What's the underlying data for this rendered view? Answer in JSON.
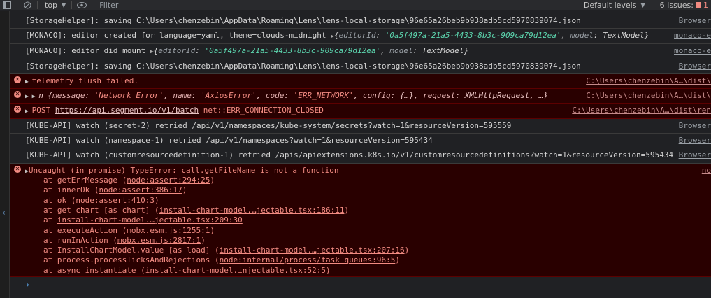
{
  "toolbar": {
    "context": "top",
    "filter_placeholder": "Filter",
    "levels": "Default levels",
    "issues_label": "6 Issues:",
    "issues_count": "1"
  },
  "messages": [
    {
      "type": "info",
      "text": "[StorageHelper]: saving C:\\Users\\chenzebin\\AppData\\Roaming\\Lens\\lens-local-storage\\96e65a26beb9b938adb5cd5970839074.json",
      "src": "Browser"
    },
    {
      "type": "info",
      "prefix": "[MONACO]: editor created for language=yaml, theme=clouds-midnight ",
      "obj": {
        "k1": "editorId",
        "v1": "'0a5f497a-21a5-4433-8b3c-909ca79d12ea'",
        "k2": "model",
        "v2": "TextModel"
      },
      "src": "monaco-e"
    },
    {
      "type": "info",
      "prefix": "[MONACO]: editor did mount ",
      "obj": {
        "k1": "editorId",
        "v1": "'0a5f497a-21a5-4433-8b3c-909ca79d12ea'",
        "k2": "model",
        "v2": "TextModel"
      },
      "src": "monaco-e"
    },
    {
      "type": "info",
      "text": "[StorageHelper]: saving C:\\Users\\chenzebin\\AppData\\Roaming\\Lens\\lens-local-storage\\96e65a26beb9b938adb5cd5970839074.json",
      "src": "Browser"
    },
    {
      "type": "error",
      "text": "telemetry flush failed.",
      "src": "C:\\Users\\chenzebin\\A…\\dist\\"
    },
    {
      "type": "error",
      "fields": {
        "n": "n",
        "message_k": "message",
        "message_v": "'Network Error'",
        "name_k": "name",
        "name_v": "'AxiosError'",
        "code_k": "code",
        "code_v": "'ERR_NETWORK'",
        "config_k": "config",
        "config_v": "{…}",
        "request_k": "request",
        "request_v": "XMLHttpRequest",
        "tail": "…}"
      },
      "src": "C:\\Users\\chenzebin\\A…\\dist\\"
    },
    {
      "type": "error",
      "method": "POST",
      "url": "https://api.segment.io/v1/batch",
      "status": "net::ERR_CONNECTION_CLOSED",
      "src": "C:\\Users\\chenzebin\\A…\\dist\\ren"
    },
    {
      "type": "info",
      "text": "[KUBE-API] watch (secret-2) retried /api/v1/namespaces/kube-system/secrets?watch=1&resourceVersion=595559",
      "src": "Browser"
    },
    {
      "type": "info",
      "text": "[KUBE-API] watch (namespace-1) retried /api/v1/namespaces?watch=1&resourceVersion=595434",
      "src": "Browser"
    },
    {
      "type": "info",
      "text": "[KUBE-API] watch (customresourcedefinition-1) retried /apis/apiextensions.k8s.io/v1/customresourcedefinitions?watch=1&resourceVersion=595434",
      "src": "Browser"
    }
  ],
  "uncaught": {
    "title": "Uncaught (in promise) TypeError: call.getFileName is not a function",
    "src": "no",
    "stack": [
      {
        "pre": "at getErrMessage (",
        "ref": "node:assert:294:25",
        "post": ")"
      },
      {
        "pre": "at innerOk (",
        "ref": "node:assert:386:17",
        "post": ")"
      },
      {
        "pre": "at ok (",
        "ref": "node:assert:410:3",
        "post": ")"
      },
      {
        "pre": "at get chart [as chart] (",
        "ref": "install-chart-model.…jectable.tsx:186:11",
        "post": ")"
      },
      {
        "pre": "at ",
        "ref": "install-chart-model.…jectable.tsx:209:30",
        "post": ""
      },
      {
        "pre": "at executeAction (",
        "ref": "mobx.esm.js:1255:1",
        "post": ")"
      },
      {
        "pre": "at runInAction (",
        "ref": "mobx.esm.js:2817:1",
        "post": ")"
      },
      {
        "pre": "at InstallChartModel.value [as load] (",
        "ref": "install-chart-model.…jectable.tsx:207:16",
        "post": ")"
      },
      {
        "pre": "at process.processTicksAndRejections (",
        "ref": "node:internal/process/task_queues:96:5",
        "post": ")"
      },
      {
        "pre": "at async instantiate (",
        "ref": "install-chart-model.injectable.tsx:52:5",
        "post": ")"
      }
    ]
  },
  "prompt": "›"
}
